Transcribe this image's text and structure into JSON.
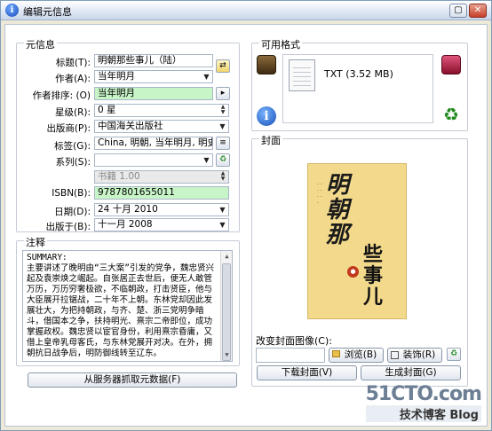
{
  "window": {
    "title": "编辑元信息"
  },
  "metadata": {
    "group_label": "元信息",
    "fields": {
      "title": {
        "label": "标题(T):",
        "value": "明朝那些事儿（陆）"
      },
      "author": {
        "label": "作者(A):",
        "value": "当年明月"
      },
      "author_sort": {
        "label": "作者排序: (O)",
        "value": "当年明月"
      },
      "rating": {
        "label": "星级(R):",
        "value": "0 星"
      },
      "publisher": {
        "label": "出版商(P):",
        "value": "中国海关出版社"
      },
      "tags": {
        "label": "标签(G):",
        "value": "China, 明朝, 当年明月, 明史"
      },
      "series": {
        "label": "系列(S):",
        "value": ""
      },
      "series_index": {
        "value": "书籍 1.00"
      },
      "isbn": {
        "label": "ISBN(B):",
        "value": "9787801655011"
      },
      "date": {
        "label": "日期(D):",
        "value": "24 十月 2010"
      },
      "pubdate": {
        "label": "出版于(B):",
        "value": "十一月 2008"
      }
    }
  },
  "comments": {
    "group_label": "注释",
    "text": "SUMMARY:\n主要讲述了晚明由“三大案”引发的党争，魏忠贤兴起及袁崇焕之崛起。自张居正去世后，便无人敢管万历，万历穷奢极欲，不临朝政，打击贤臣，他与大臣展开拉锯战，二十年不上朝。东林党却因此发展壮大，为把持朝政，与齐、楚、浙三党明争暗斗，借国本之争，扶持明光、熹宗二帝即位，成功掌握政权。魏忠贤以宦官身份，利用熹宗昏庸，又借上皇帝乳母客氏，与东林党展开对决。在外，拥朝抗日战争后，明防御线转至辽东。"
  },
  "fetch_button": "从服务器抓取元数据(F)",
  "formats": {
    "group_label": "可用格式",
    "items": [
      {
        "name": "TXT (3.52 MB)"
      }
    ]
  },
  "cover": {
    "group_label": "封面",
    "title_art": "明朝那些事儿",
    "change_label": "改变封面图像(C):",
    "path_value": "",
    "browse_button": "浏览(B)",
    "trim_button": "装饰(R)",
    "download_button": "下载封面(V)",
    "generate_button": "生成封面(G)"
  },
  "watermark": {
    "site": "51CTO.com",
    "blog": "技术博客 Blog"
  }
}
